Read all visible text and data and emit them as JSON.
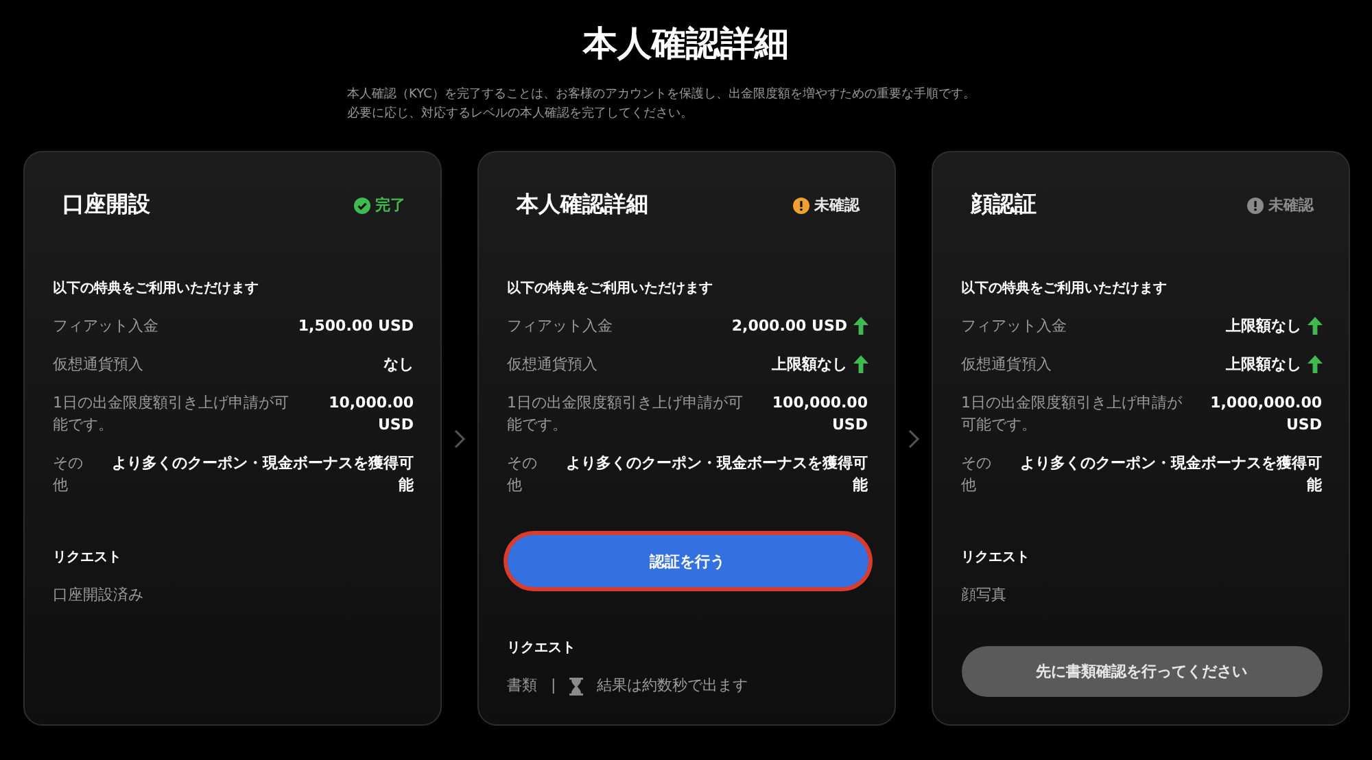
{
  "page": {
    "title": "本人確認詳細",
    "description": [
      "本人確認（KYC）を完了することは、お客様のアカウントを保護し、出金限度額を増やすための重要な手順です。",
      "必要に応じ、対応するレベルの本人確認を完了してください。"
    ]
  },
  "cards": [
    {
      "title": "口座開設",
      "status": {
        "kind": "done",
        "label": "完了"
      },
      "sections": [
        {
          "kind": "benefits",
          "heading": "以下の特典をご利用いただけます",
          "rows": [
            {
              "label": "フィアット入金",
              "value": "1,500.00 USD",
              "increased": false
            },
            {
              "label": "仮想通貨預入",
              "value": "なし",
              "increased": false
            },
            {
              "label": "1日の出金限度額引き上げ申請が可能です。",
              "value": "10,000.00 USD",
              "increased": false
            },
            {
              "label": "その他",
              "value": "より多くのクーポン・現金ボーナスを獲得可能",
              "increased": false
            }
          ]
        },
        {
          "kind": "request",
          "heading": "リクエスト",
          "item": "口座開設済み"
        }
      ]
    },
    {
      "title": "本人確認詳細",
      "status": {
        "kind": "pending",
        "label": "未確認"
      },
      "sections": [
        {
          "kind": "benefits",
          "heading": "以下の特典をご利用いただけます",
          "rows": [
            {
              "label": "フィアット入金",
              "value": "2,000.00 USD",
              "increased": true
            },
            {
              "label": "仮想通貨預入",
              "value": "上限額なし",
              "increased": true
            },
            {
              "label": "1日の出金限度額引き上げ申請が可能です。",
              "value": "100,000.00 USD",
              "increased": false
            },
            {
              "label": "その他",
              "value": "より多くのクーポン・現金ボーナスを獲得可能",
              "increased": false
            }
          ]
        },
        {
          "kind": "button",
          "label": "認証を行う",
          "disabled": false,
          "focused": true
        },
        {
          "kind": "request",
          "heading": "リクエスト",
          "item": "書類",
          "separator": "|",
          "note": "結果は約数秒で出ます"
        }
      ]
    },
    {
      "title": "顔認証",
      "status": {
        "kind": "locked",
        "label": "未確認"
      },
      "sections": [
        {
          "kind": "benefits",
          "heading": "以下の特典をご利用いただけます",
          "rows": [
            {
              "label": "フィアット入金",
              "value": "上限額なし",
              "increased": true
            },
            {
              "label": "仮想通貨預入",
              "value": "上限額なし",
              "increased": true
            },
            {
              "label": "1日の出金限度額引き上げ申請が可能です。",
              "value": "1,000,000.00 USD",
              "increased": false
            },
            {
              "label": "その他",
              "value": "より多くのクーポン・現金ボーナスを獲得可能",
              "increased": false
            }
          ]
        },
        {
          "kind": "request",
          "heading": "リクエスト",
          "item": "顔写真"
        },
        {
          "kind": "button",
          "label": "先に書類確認を行ってください",
          "disabled": true,
          "focused": false
        }
      ]
    }
  ]
}
